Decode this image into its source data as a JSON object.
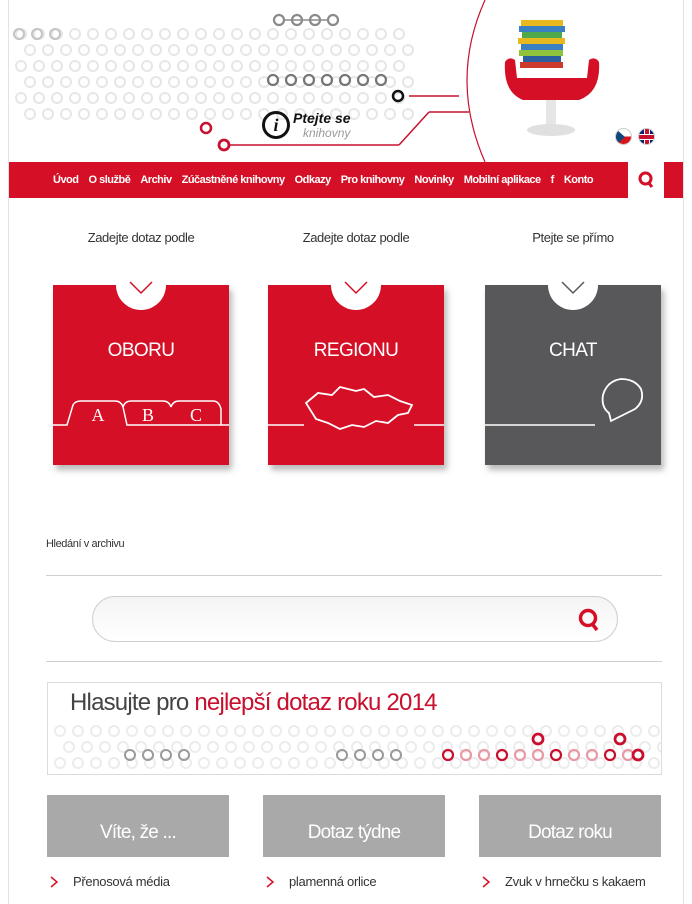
{
  "header": {
    "logo_line1": "Ptejte se",
    "logo_line2": "knihovny",
    "languages": [
      "cs",
      "en"
    ]
  },
  "nav": {
    "items": [
      "Úvod",
      "O službě",
      "Archiv",
      "Zúčastněné knihovny",
      "Odkazy",
      "Pro knihovny",
      "Novinky",
      "Mobilní aplikace",
      "f",
      "Konto"
    ],
    "search_icon": "search-icon"
  },
  "boxes": [
    {
      "label": "Zadejte dotaz podle",
      "title": "OBORU",
      "art_letters": [
        "A",
        "B",
        "C"
      ]
    },
    {
      "label": "Zadejte dotaz podle",
      "title": "REGIONU"
    },
    {
      "label": "Ptejte se přímo",
      "title": "CHAT"
    }
  ],
  "archive": {
    "label": "Hledání v archivu",
    "search_value": "",
    "search_icon": "search-icon"
  },
  "vote": {
    "prefix": "Hlasujte pro ",
    "highlight": "nejlepší dotaz roku 2014"
  },
  "tiles": [
    {
      "title": "Víte, že ...",
      "link": "Přenosová média"
    },
    {
      "title": "Dotaz týdne",
      "link": "plamenná orlice"
    },
    {
      "title": "Dotaz roku",
      "link": "Zvuk v hrnečku s kakaem"
    }
  ],
  "colors": {
    "accent": "#d40f26",
    "grey_box": "#58585a",
    "tile": "#a9a9a9"
  }
}
